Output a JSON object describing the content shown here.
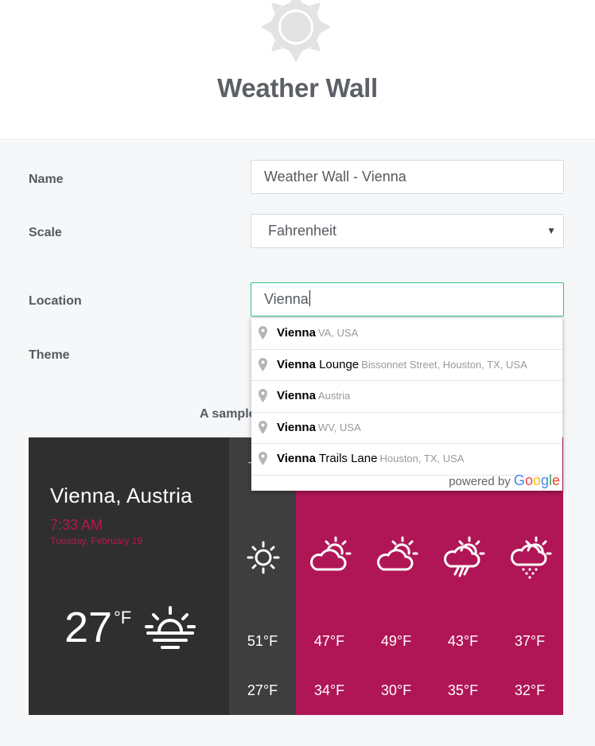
{
  "header": {
    "title": "Weather Wall",
    "logo_icon": "sun-icon"
  },
  "form": {
    "name_label": "Name",
    "name_value": "Weather Wall - Vienna",
    "scale_label": "Scale",
    "scale_value": "Fahrenheit",
    "location_label": "Location",
    "location_value": "Vienna",
    "theme_label": "Theme",
    "sample_text": "A sample"
  },
  "autocomplete": {
    "items": [
      {
        "match": "Vienna",
        "rest": "",
        "secondary": "VA, USA"
      },
      {
        "match": "Vienna",
        "rest": " Lounge",
        "secondary": "Bissonnet Street, Houston, TX, USA"
      },
      {
        "match": "Vienna",
        "rest": "",
        "secondary": "Austria"
      },
      {
        "match": "Vienna",
        "rest": "",
        "secondary": "WV, USA"
      },
      {
        "match": "Vienna",
        "rest": " Trails Lane",
        "secondary": "Houston, TX, USA"
      }
    ],
    "powered_by": "powered by"
  },
  "preview": {
    "city": "Vienna, Austria",
    "time": "7:33 AM",
    "date": "Tuesday, February 19",
    "current_temp": "27",
    "current_unit": "°F",
    "current_icon": "sunrise-icon",
    "first_day_peek": "T",
    "forecast": [
      {
        "icon": "sun-icon",
        "high": "51°F",
        "low": "27°F"
      },
      {
        "icon": "partly-cloudy-icon",
        "high": "47°F",
        "low": "34°F"
      },
      {
        "icon": "partly-cloudy-icon",
        "high": "49°F",
        "low": "30°F"
      },
      {
        "icon": "rain-cloud-icon",
        "high": "43°F",
        "low": "35°F"
      },
      {
        "icon": "snow-cloud-icon",
        "high": "37°F",
        "low": "32°F"
      }
    ],
    "colors": {
      "dark": "#2f2f30",
      "accent": "#b01656"
    }
  }
}
